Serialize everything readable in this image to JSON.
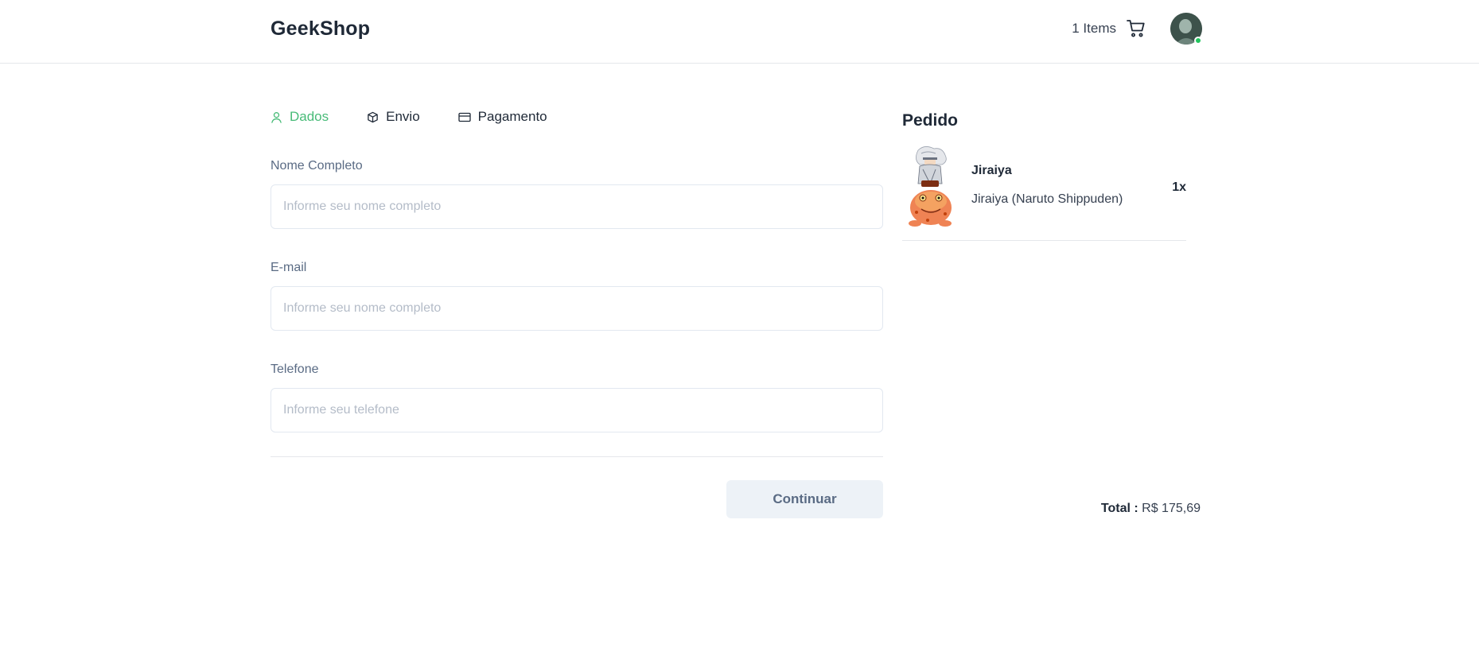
{
  "header": {
    "brand": "GeekShop",
    "cart_count": "1 Items",
    "cart_icon": "cart-icon",
    "avatar_icon": "user-avatar",
    "status_color": "#22c55e"
  },
  "steps": [
    {
      "label": "Dados",
      "icon": "user-icon",
      "active": true
    },
    {
      "label": "Envio",
      "icon": "box-icon",
      "active": false
    },
    {
      "label": "Pagamento",
      "icon": "credit-card-icon",
      "active": false
    }
  ],
  "form": {
    "name": {
      "label": "Nome Completo",
      "placeholder": "Informe seu nome completo",
      "value": ""
    },
    "email": {
      "label": "E-mail",
      "placeholder": "Informe seu nome completo",
      "value": ""
    },
    "phone": {
      "label": "Telefone",
      "placeholder": "Informe seu telefone",
      "value": ""
    },
    "continue_label": "Continuar"
  },
  "order": {
    "title": "Pedido",
    "items": [
      {
        "name": "Jiraiya",
        "description": "Jiraiya (Naruto Shippuden)",
        "quantity": "1x"
      }
    ],
    "total_label": "Total :",
    "total_value": "R$ 175,69"
  },
  "colors": {
    "accent": "#48bb78",
    "label": "#5a6b84",
    "border": "#e2e8f0",
    "button_bg": "#edf2f7"
  }
}
